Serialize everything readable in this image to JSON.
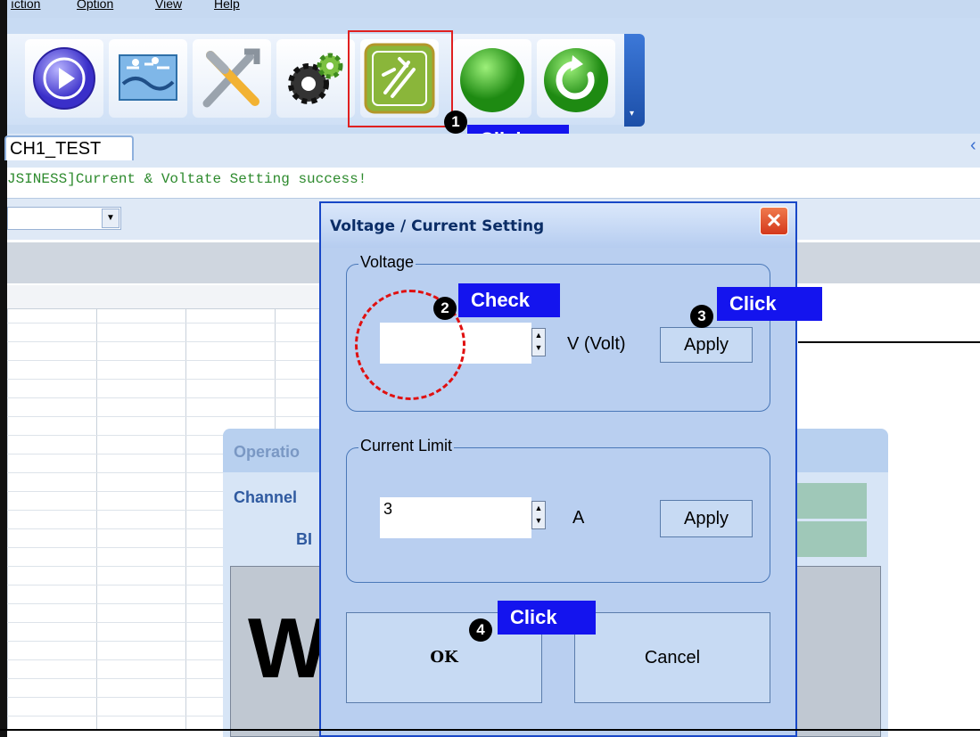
{
  "menubar": {
    "items": [
      "ıction",
      "Option",
      "View",
      "Help"
    ]
  },
  "toolbar": {
    "buttons": [
      "play-icon",
      "document-icon",
      "tools-icon",
      "gears-icon",
      "voltage-setting-icon",
      "green-status-icon",
      "refresh-icon"
    ]
  },
  "tabs": {
    "active": "CH1_TEST"
  },
  "log": {
    "text": "JSINESS]Current & Voltate Setting success!"
  },
  "operation_window": {
    "title": "Operatio",
    "channel": "Channel",
    "bi": "BI",
    "big_letter": "W"
  },
  "dialog": {
    "title": "Voltage / Current Setting",
    "close": "✕",
    "voltage": {
      "group_label": "Voltage",
      "value": "",
      "unit": "V (Volt)",
      "apply": "Apply"
    },
    "current": {
      "group_label": "Current Limit",
      "value": "3",
      "unit": "A",
      "apply": "Apply"
    },
    "ok": "OK",
    "cancel": "Cancel"
  },
  "annotations": [
    {
      "number": "1",
      "label": "Click"
    },
    {
      "number": "2",
      "label": "Check"
    },
    {
      "number": "3",
      "label": "Click"
    },
    {
      "number": "4",
      "label": "Click"
    }
  ],
  "colors": {
    "callout": "#1414ee",
    "highlight": "#e02020",
    "dialog_border": "#1847c7",
    "log_text": "#2d8a2d"
  }
}
